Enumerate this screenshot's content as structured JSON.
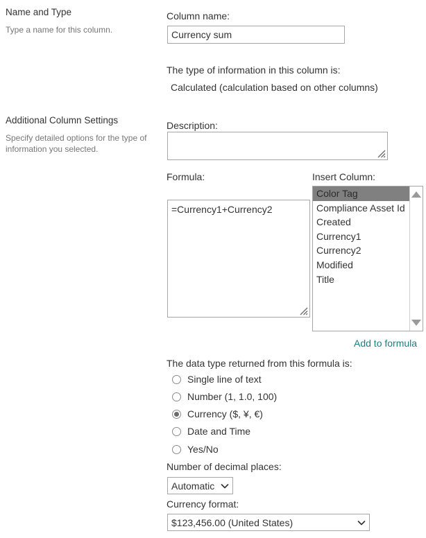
{
  "sections": [
    {
      "heading": "Name and Type",
      "description": "Type a name for this column."
    },
    {
      "heading": "Additional Column Settings",
      "description": "Specify detailed options for the type of information you selected."
    }
  ],
  "form": {
    "column_name_label": "Column name:",
    "column_name_value": "Currency sum",
    "type_info_label": "The type of information in this column is:",
    "type_info_value": "Calculated (calculation based on other columns)",
    "description_label": "Description:",
    "description_value": "",
    "formula_label": "Formula:",
    "formula_value": "=Currency1+Currency2",
    "insert_column_label": "Insert Column:",
    "insert_columns": [
      "Color Tag",
      "Compliance Asset Id",
      "Created",
      "Currency1",
      "Currency2",
      "Modified",
      "Title"
    ],
    "insert_column_selected": "Color Tag",
    "add_to_formula_link": "Add to formula",
    "data_type_label": "The data type returned from this formula is:",
    "data_types": [
      {
        "label": "Single line of text",
        "checked": false
      },
      {
        "label": "Number (1, 1.0, 100)",
        "checked": false
      },
      {
        "label": "Currency ($, ¥, €)",
        "checked": true
      },
      {
        "label": "Date and Time",
        "checked": false
      },
      {
        "label": "Yes/No",
        "checked": false
      }
    ],
    "decimal_places_label": "Number of decimal places:",
    "decimal_places_value": "Automatic",
    "currency_format_label": "Currency format:",
    "currency_format_value": "$123,456.00 (United States)"
  },
  "colors": {
    "link": "#1a7f80",
    "text": "#333333",
    "muted": "#767676",
    "border": "#a6a6a6",
    "selection": "#808080"
  }
}
